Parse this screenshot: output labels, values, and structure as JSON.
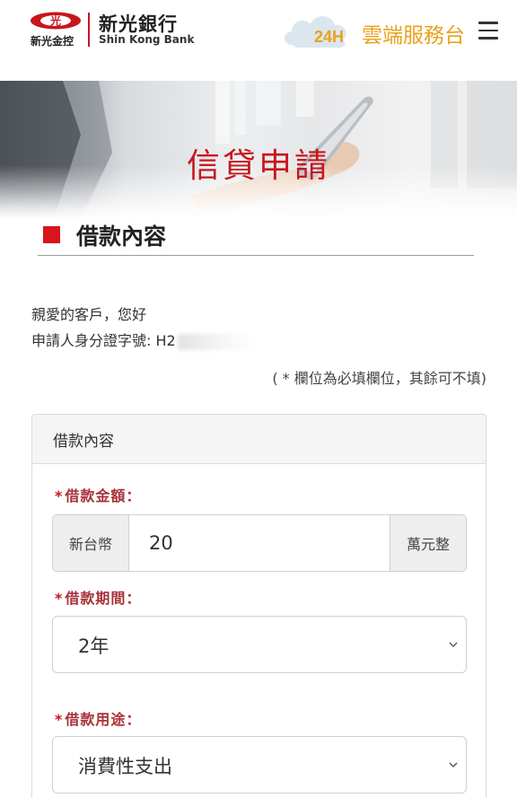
{
  "header": {
    "logo_group_name": "新光金控",
    "logo_bank_cn": "新光銀行",
    "logo_bank_en": "Shin Kong Bank",
    "badge_24h": "24H",
    "service_title": "雲端服務台",
    "menu_icon": "hamburger-menu-icon"
  },
  "banner": {
    "title": "信貸申請"
  },
  "section": {
    "title": "借款內容"
  },
  "greeting": {
    "salutation": "親愛的客戶，您好",
    "id_label": "申請人身分證字號: H2",
    "required_note": "( * 欄位為必填欄位，其餘可不填)"
  },
  "panel": {
    "heading": "借款內容",
    "amount": {
      "label": "借款金額：",
      "prefix": "新台幣",
      "value": "20",
      "suffix": "萬元整"
    },
    "term": {
      "label": "借款期間：",
      "value": "2年"
    },
    "purpose": {
      "label": "借款用途：",
      "value": "消費性支出"
    },
    "required_mark": "*"
  },
  "colors": {
    "brand_red": "#c8161d",
    "label_red": "#a8323a",
    "service_orange": "#e8a21c"
  }
}
